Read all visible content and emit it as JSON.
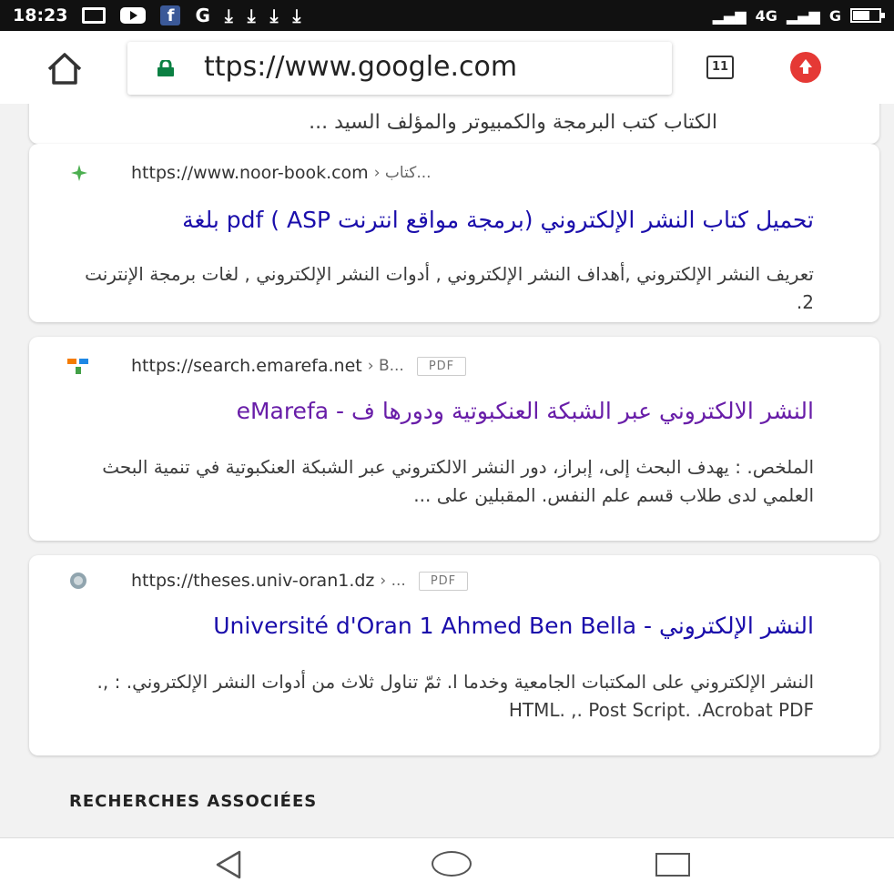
{
  "status_bar": {
    "time": "18:23",
    "network": "4G",
    "network2": "G"
  },
  "browser": {
    "url": "ttps://www.google.com",
    "tab_count": "11"
  },
  "results": {
    "top_snippet": "الكتاب كتب البرمجة والكمبيوتر والمؤلف السيد ...",
    "items": [
      {
        "url": "https://www.noor-book.com",
        "crumb": "› كتاب...",
        "title": "تحميل كتاب النشر الإلكتروني (برمجة مواقع انترنت ASP ) pdf بلغة",
        "snippet": "تعريف النشر الإلكتروني ,أهداف النشر الإلكتروني , أدوات النشر الإلكتروني , لغات برمجة الإنترنت 2."
      },
      {
        "url": "https://search.emarefa.net",
        "crumb": "› B...",
        "badge": "PDF",
        "title": "النشر الالكتروني عبر الشبكة العنكبوتية ودورها ف - eMarefa",
        "snippet": "الملخص. : يهدف البحث إلى، إبراز، دور النشر الالكتروني عبر الشبكة العنكبوتية في تنمية البحث العلمي لدى طلاب قسم علم النفس. المقبلين على ..."
      },
      {
        "url": "https://theses.univ-oran1.dz",
        "crumb": "› ...",
        "badge": "PDF",
        "title": "النشر الإلكتروني - Université d'Oran 1 Ahmed Ben Bella",
        "snippet": "النشر الإلكتروني على المكتبات الجامعية وخدما ا. ثمّ تناول ثلاث من أدوات النشر الإلكتروني. : ,. HTML. ,. Post Script. .Acrobat PDF"
      }
    ],
    "related_heading": "RECHERCHES ASSOCIÉES"
  },
  "colors": {
    "link_blue": "#1a0dab",
    "link_visited": "#681da8",
    "lock_green": "#0b8043",
    "update_red": "#e53935"
  }
}
